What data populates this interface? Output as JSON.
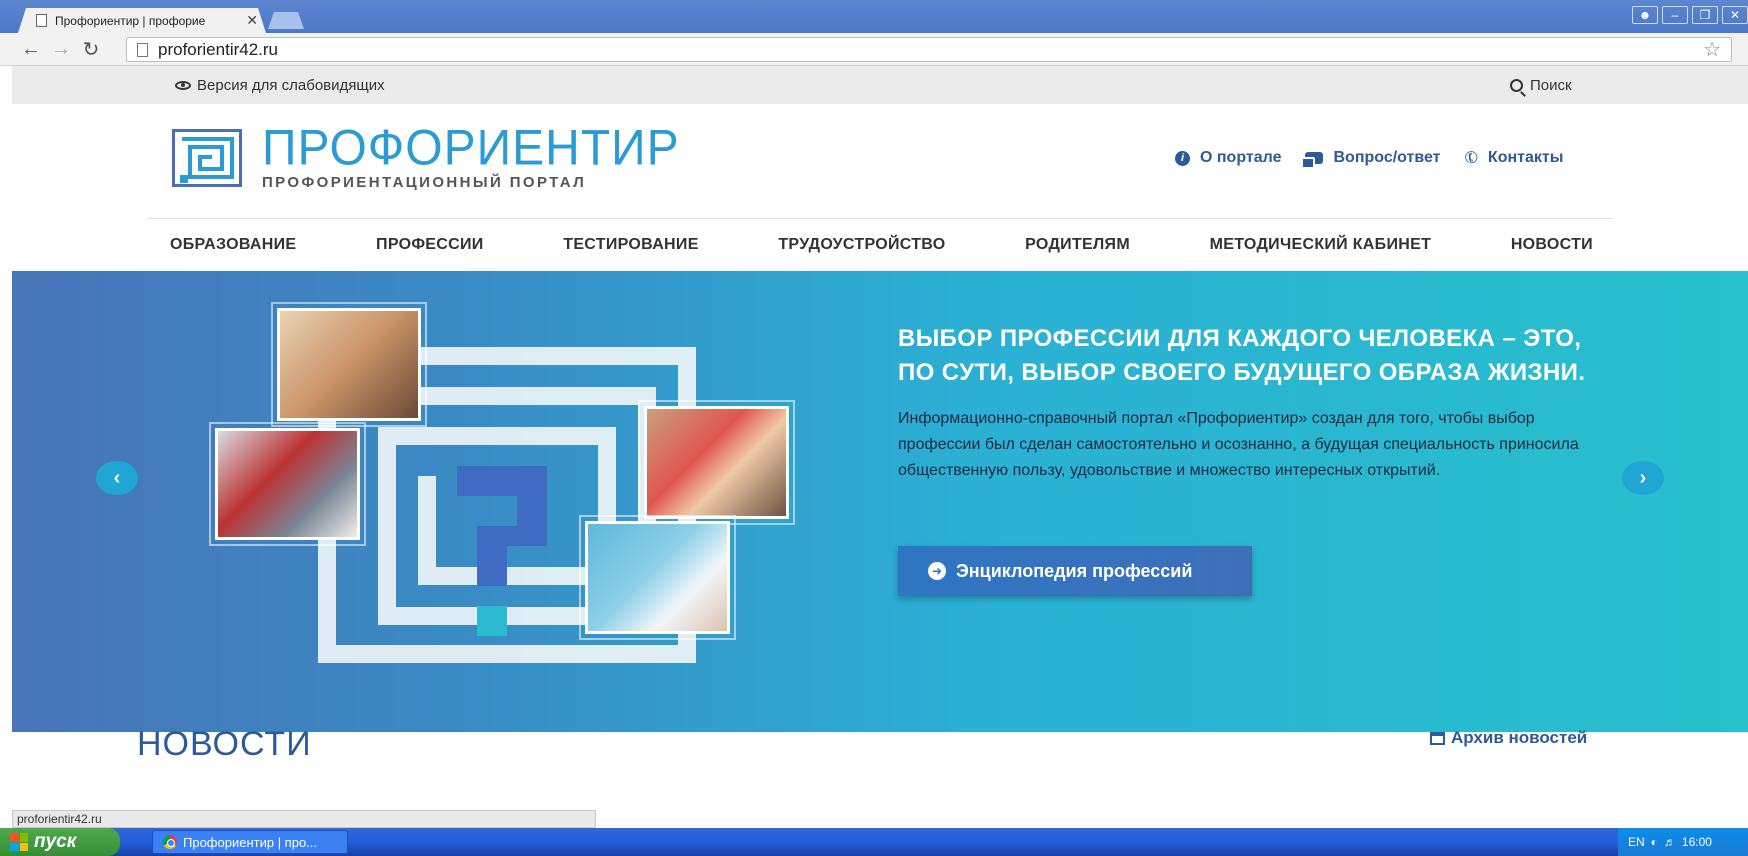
{
  "browser": {
    "tab_title": "Профориентир | профорие",
    "tab_close": "✕",
    "url": "proforientir42.ru",
    "status_url": "proforientir42.ru"
  },
  "topbar": {
    "accessibility_label": "Версия для слабовидящих",
    "search_label": "Поиск"
  },
  "header": {
    "logo_name": "ПРОФОРИЕНТИР",
    "logo_subtitle": "ПРОФОРИЕНТАЦИОННЫЙ ПОРТАЛ",
    "links": [
      {
        "label": "О портале",
        "icon": "info-icon"
      },
      {
        "label": "Вопрос/ответ",
        "icon": "chat-icon"
      },
      {
        "label": "Контакты",
        "icon": "phone-icon"
      }
    ]
  },
  "menu": {
    "items": [
      "ОБРАЗОВАНИЕ",
      "ПРОФЕССИИ",
      "ТЕСТИРОВАНИЕ",
      "ТРУДОУСТРОЙСТВО",
      "РОДИТЕЛЯМ",
      "МЕТОДИЧЕСКИЙ КАБИНЕТ",
      "НОВОСТИ"
    ]
  },
  "hero": {
    "title_line1": "ВЫБОР ПРОФЕССИИ ДЛЯ КАЖДОГО ЧЕЛОВЕКА – ЭТО,",
    "title_line2": "ПО СУТИ, ВЫБОР СВОЕГО БУДУЩЕГО ОБРАЗА ЖИЗНИ.",
    "text": "Информационно-справочный портал «Профориентир» создан для того, чтобы выбор профессии был сделан самостоятельно и осознанно, а будущая специальность приносила общественную пользу, удовольствие и множество интересных открытий.",
    "button_label": "Энциклопедия профессий",
    "prev_arrow": "‹",
    "next_arrow": "›"
  },
  "news": {
    "title": "НОВОСТИ",
    "archive_label": "Архив новостей"
  },
  "taskbar": {
    "start_label": "пуск",
    "task_label": "Профориентир | про...",
    "lang": "EN",
    "clock": "16:00"
  },
  "colors": {
    "brand_blue": "#2b9bd4",
    "dark_blue": "#2e5a9a",
    "hero_left": "#4874b8",
    "hero_right": "#27c0cc"
  }
}
